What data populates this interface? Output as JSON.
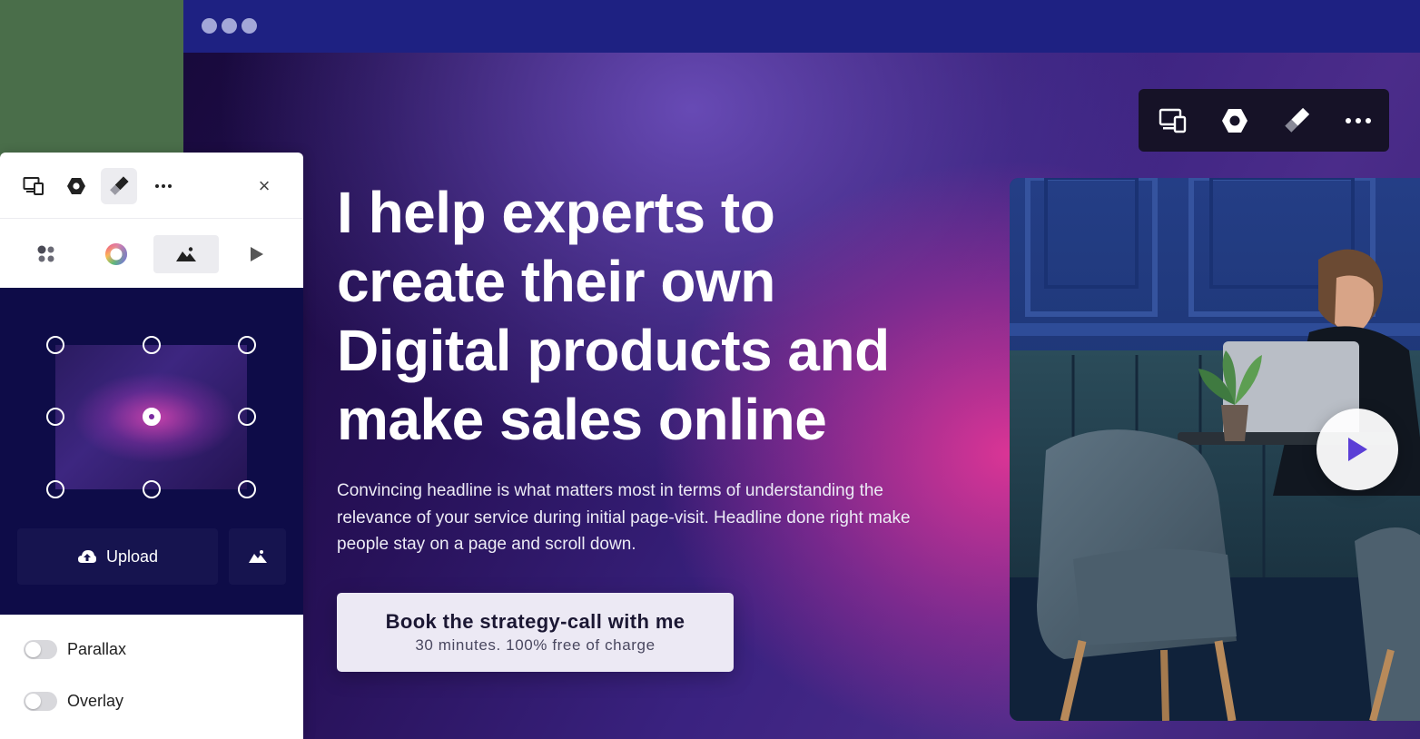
{
  "headline": "I help experts to create their own Digital products and make sales online",
  "subtext": "Convincing headline is what matters most in terms of understanding the relevance of your service during initial page-visit. Headline done right make people stay on a page and scroll down.",
  "cta": {
    "title": "Book the strategy-call with me",
    "subtitle": "30 minutes. 100% free of charge"
  },
  "toolbar": {
    "icons": [
      "devices-icon",
      "settings-icon",
      "brush-icon",
      "more-icon"
    ]
  },
  "panel": {
    "top_icons": [
      "devices-icon",
      "settings-icon",
      "brush-icon",
      "more-icon"
    ],
    "close_label": "×",
    "tabs": [
      "layout-icon",
      "color-wheel-icon",
      "image-icon",
      "play-icon"
    ],
    "active_tab": "image-icon",
    "upload_label": "Upload",
    "toggles": [
      {
        "label": "Parallax",
        "on": false
      },
      {
        "label": "Overlay",
        "on": false
      }
    ]
  },
  "colors": {
    "topbar": "#1e2182",
    "panel_dark": "#0e0c48",
    "accent_pink": "#e2359a",
    "play_arrow": "#5b3fd6"
  }
}
